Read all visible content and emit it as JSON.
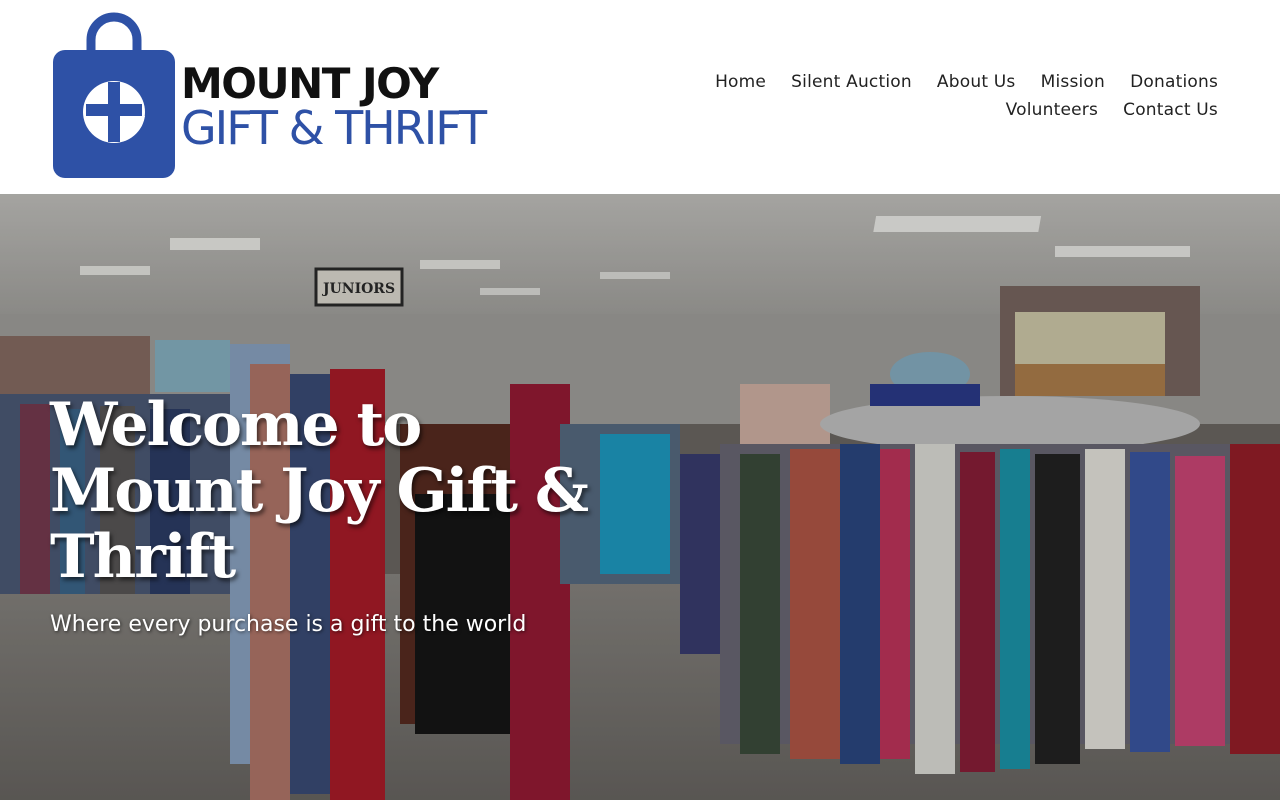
{
  "brand": {
    "name_line1": "MOUNT JOY",
    "name_line2": "GIFT & THRIFT",
    "logo_icon": "shopping-bag-cross-icon",
    "primary_color": "#2e51a6",
    "text_color": "#111111"
  },
  "nav": {
    "items": [
      {
        "label": "Home"
      },
      {
        "label": "Silent Auction"
      },
      {
        "label": "About Us"
      },
      {
        "label": "Mission"
      },
      {
        "label": "Donations"
      },
      {
        "label": "Volunteers"
      },
      {
        "label": "Contact Us"
      }
    ]
  },
  "hero": {
    "title": "Welcome to Mount Joy Gift & Thrift",
    "subtitle": "Where every purchase is a gift to the world",
    "sign_text": "JUNIORS"
  }
}
